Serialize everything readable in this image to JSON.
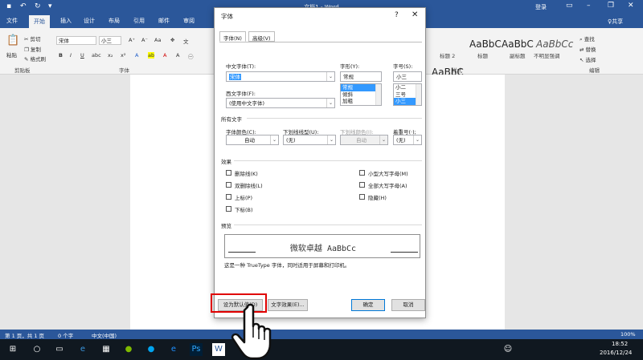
{
  "window": {
    "title": "文档1 - Word",
    "login": "登录",
    "share": "♀共享",
    "qa_icons": [
      "save-icon",
      "undo-icon",
      "redo-icon",
      "customize-icon"
    ]
  },
  "tabs": [
    "文件",
    "开始",
    "插入",
    "设计",
    "布局",
    "引用",
    "邮件",
    "审阅"
  ],
  "active_tab": "开始",
  "ribbon": {
    "paste": "粘贴",
    "cut": "剪切",
    "copy": "复制",
    "format_painter": "格式刷",
    "clipboard_group": "剪贴板",
    "font_name": "宋体",
    "font_size": "小三",
    "font_group": "字体",
    "bold": "B",
    "italic": "I",
    "underline": "U",
    "styles": [
      {
        "sample": "AaBbC",
        "label": "标题 2"
      },
      {
        "sample": "AaBbC",
        "label": "标题"
      },
      {
        "sample": "AaBbC",
        "label": "副标题"
      },
      {
        "sample": "AaBbCc",
        "label": "不明显强调"
      }
    ],
    "styles_group": "样式",
    "find": "查找",
    "replace": "替换",
    "select": "选择",
    "editing_group": "编辑"
  },
  "dialog": {
    "title": "字体",
    "help": "?",
    "close": "✕",
    "tabs": [
      "字体(N)",
      "高级(V)"
    ],
    "chinese_font_label": "中文字体(T):",
    "chinese_font_value": "宋体",
    "western_font_label": "西文字体(F):",
    "western_font_value": "(使用中文字体)",
    "style_label": "字形(Y):",
    "style_value": "常规",
    "style_options": [
      "常规",
      "倾斜",
      "加粗"
    ],
    "size_label": "字号(S):",
    "size_value": "小三",
    "size_options": [
      "小二",
      "三号",
      "小三"
    ],
    "all_text_section": "所有文字",
    "font_color_label": "字体颜色(C):",
    "font_color_value": "自动",
    "underline_type_label": "下划线线型(U):",
    "underline_type_value": "(无)",
    "underline_color_label": "下划线颜色(I):",
    "underline_color_value": "自动",
    "emphasis_label": "着重号(·);",
    "emphasis_value": "(无)",
    "effects_section": "效果",
    "effects_left": [
      "删除线(K)",
      "双删除线(L)",
      "上标(P)",
      "下标(B)"
    ],
    "effects_right": [
      "小型大写字母(M)",
      "全部大写字母(A)",
      "隐藏(H)"
    ],
    "preview_section": "预览",
    "preview_text": "微软卓越  AaBbCc",
    "note": "这是一种 TrueType 字体，同时适用于屏幕和打印机。",
    "set_default": "设为默认值(D)",
    "text_effects": "文字效果(E)...",
    "ok": "确定",
    "cancel": "取消"
  },
  "status": {
    "page": "第 1 页，共 1 页",
    "words": "0 个字",
    "language": "中文(中国)",
    "zoom": "100%"
  },
  "taskbar": {
    "time": "18:52",
    "date": "2016/12/24"
  }
}
